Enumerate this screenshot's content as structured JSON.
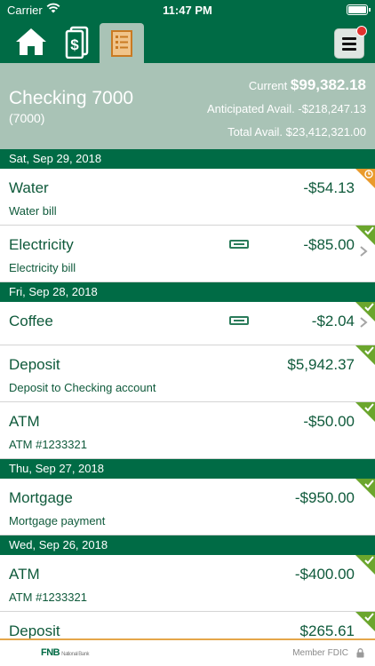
{
  "status_bar": {
    "carrier": "Carrier",
    "time": "11:47 PM"
  },
  "toolbar": {
    "icons": [
      "home-icon",
      "money-icon",
      "ledger-icon",
      "menu-icon"
    ],
    "active": "ledger-icon",
    "colors": {
      "bar": "#006b45",
      "active_tab": "#a9c3b6",
      "notification": "#e2322e"
    }
  },
  "account": {
    "name": "Checking 7000",
    "number": "(7000)",
    "current_label": "Current",
    "current_value": "$99,382.18",
    "anticipated_label": "Anticipated Avail.",
    "anticipated_value": "-$218,247.13",
    "total_label": "Total Avail.",
    "total_value": "$23,412,321.00"
  },
  "groups": [
    {
      "date": "Sat, Sep 29, 2018",
      "transactions": [
        {
          "title": "Water",
          "subtitle": "Water bill",
          "amount": "-$54.13",
          "status": "pending",
          "has_memo": false,
          "has_chevron": false
        },
        {
          "title": "Electricity",
          "subtitle": "Electricity bill",
          "amount": "-$85.00",
          "status": "cleared",
          "has_memo": true,
          "has_chevron": true
        }
      ]
    },
    {
      "date": "Fri, Sep 28, 2018",
      "transactions": [
        {
          "title": "Coffee",
          "subtitle": "",
          "amount": "-$2.04",
          "status": "cleared",
          "has_memo": true,
          "has_chevron": true
        },
        {
          "title": "Deposit",
          "subtitle": "Deposit to Checking account",
          "amount": "$5,942.37",
          "status": "cleared",
          "has_memo": false,
          "has_chevron": false
        },
        {
          "title": "ATM",
          "subtitle": "ATM #1233321",
          "amount": "-$50.00",
          "status": "cleared",
          "has_memo": false,
          "has_chevron": false
        }
      ]
    },
    {
      "date": "Thu, Sep 27, 2018",
      "transactions": [
        {
          "title": "Mortgage",
          "subtitle": "Mortgage payment",
          "amount": "-$950.00",
          "status": "cleared",
          "has_memo": false,
          "has_chevron": false
        }
      ]
    },
    {
      "date": "Wed, Sep 26, 2018",
      "transactions": [
        {
          "title": "ATM",
          "subtitle": "ATM #1233321",
          "amount": "-$400.00",
          "status": "cleared",
          "has_memo": false,
          "has_chevron": false
        },
        {
          "title": "Deposit",
          "subtitle": "",
          "amount": "$265.61",
          "status": "cleared",
          "has_memo": false,
          "has_chevron": false
        }
      ]
    }
  ],
  "footer": {
    "logo": "FNB",
    "logo_sub": "National Bank",
    "fdic": "Member FDIC"
  },
  "colors": {
    "cleared": "#6ba62d",
    "pending": "#e99a2c",
    "text_green": "#0f5a3b",
    "footer_line": "#e5a64a"
  }
}
